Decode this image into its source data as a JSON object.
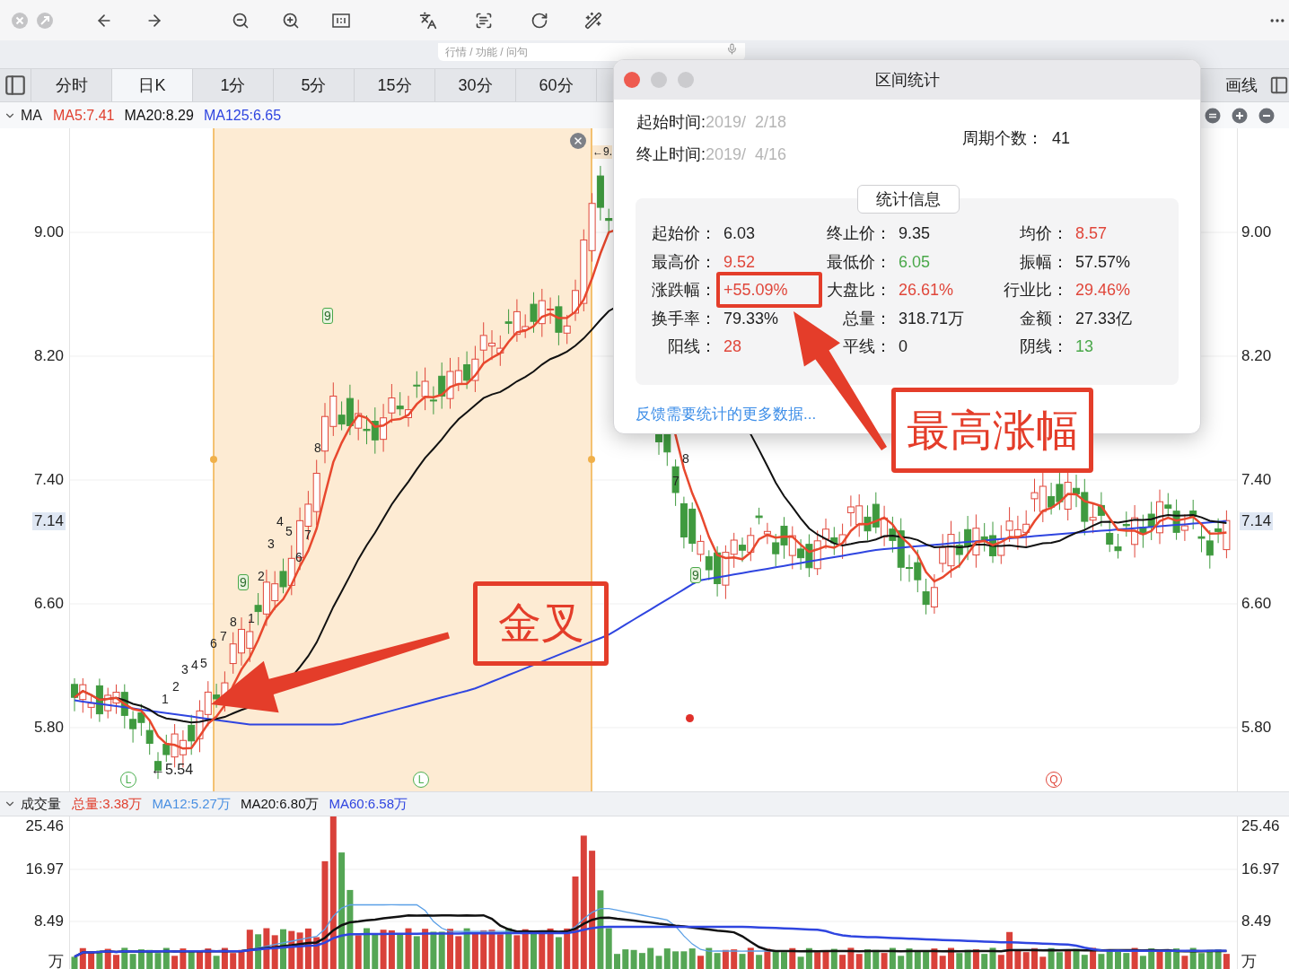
{
  "toolbar": {
    "search": {
      "placeholder": "行情 / 功能 / 问句"
    }
  },
  "period_tabs": [
    {
      "label": "分时",
      "selected": false
    },
    {
      "label": "日K",
      "selected": true
    },
    {
      "label": "1分",
      "selected": false
    },
    {
      "label": "5分",
      "selected": false
    },
    {
      "label": "15分",
      "selected": false
    },
    {
      "label": "30分",
      "selected": false
    },
    {
      "label": "60分",
      "selected": false
    }
  ],
  "draw_button": {
    "label": "画线"
  },
  "ma_legend": {
    "title": "MA",
    "items": [
      {
        "text": "MA5:7.41",
        "color": "#e0402f"
      },
      {
        "text": "MA20:8.29",
        "color": "#111111"
      },
      {
        "text": "MA125:6.65",
        "color": "#2f45e0"
      }
    ]
  },
  "left_price_axis": [
    {
      "text": "9.00",
      "highlighted": false
    },
    {
      "text": "8.20",
      "highlighted": false
    },
    {
      "text": "7.40",
      "highlighted": false
    },
    {
      "text": "7.14",
      "highlighted": true
    },
    {
      "text": "6.60",
      "highlighted": false
    },
    {
      "text": "5.80",
      "highlighted": false
    }
  ],
  "right_price_axis": [
    {
      "text": "9.00",
      "highlighted": false
    },
    {
      "text": "8.20",
      "highlighted": false
    },
    {
      "text": "7.40",
      "highlighted": false
    },
    {
      "text": "7.14",
      "highlighted": true
    },
    {
      "text": "6.60",
      "highlighted": false
    },
    {
      "text": "5.80",
      "highlighted": false
    }
  ],
  "price_labels": {
    "low": "←5.54",
    "high": "←9."
  },
  "count_marks": [
    {
      "text": "9",
      "boxed": true
    },
    {
      "text": "8",
      "boxed": false
    },
    {
      "text": "4",
      "boxed": false
    },
    {
      "text": "5",
      "boxed": false
    },
    {
      "text": "7",
      "boxed": false
    },
    {
      "text": "3",
      "boxed": false
    },
    {
      "text": "6",
      "boxed": false
    },
    {
      "text": "9",
      "boxed": true
    },
    {
      "text": "2",
      "boxed": false
    },
    {
      "text": "8",
      "boxed": false
    },
    {
      "text": "1",
      "boxed": false
    },
    {
      "text": "6",
      "boxed": false
    },
    {
      "text": "7",
      "boxed": false
    },
    {
      "text": "3",
      "boxed": false
    },
    {
      "text": "4",
      "boxed": false
    },
    {
      "text": "5",
      "boxed": false
    },
    {
      "text": "2",
      "boxed": false
    },
    {
      "text": "1",
      "boxed": false
    },
    {
      "text": "8",
      "boxed": false
    },
    {
      "text": "7",
      "boxed": false
    },
    {
      "text": "9",
      "boxed": true
    }
  ],
  "signals": [
    {
      "text": "L",
      "color": "#4caf50"
    },
    {
      "text": "L",
      "color": "#4caf50"
    },
    {
      "text": "Q",
      "color": "#e0463a"
    }
  ],
  "volume_legend": {
    "title": "成交量",
    "items": [
      {
        "text": "总量:3.38万",
        "color": "#e0402f"
      },
      {
        "text": "MA12:5.27万",
        "color": "#4a90e2"
      },
      {
        "text": "MA20:6.80万",
        "color": "#111111"
      },
      {
        "text": "MA60:6.58万",
        "color": "#2f45e0"
      }
    ]
  },
  "left_volume_axis": [
    "25.46",
    "16.97",
    "8.49",
    "万"
  ],
  "right_volume_axis": [
    "25.46",
    "16.97",
    "8.49",
    "万"
  ],
  "dialog": {
    "title": "区间统计",
    "start": {
      "label": "起始时间:",
      "value": "2019/  2/18"
    },
    "end": {
      "label": "终止时间:",
      "value": "2019/  4/16"
    },
    "periods": {
      "label": "周期个数：",
      "value": "41"
    },
    "section_title": "统计信息",
    "stats": [
      {
        "label": "起始价：",
        "value": "6.03",
        "color": "#222222"
      },
      {
        "label": "终止价：",
        "value": "9.35",
        "color": "#222222"
      },
      {
        "label": "均价：",
        "value": "8.57",
        "color": "#e0463a"
      },
      {
        "label": "最高价：",
        "value": "9.52",
        "color": "#e0463a"
      },
      {
        "label": "最低价：",
        "value": "6.05",
        "color": "#4aa84a"
      },
      {
        "label": "振幅：",
        "value": "57.57%",
        "color": "#222222"
      },
      {
        "label": "涨跌幅：",
        "value": "+55.09%",
        "color": "#e0463a"
      },
      {
        "label": "大盘比：",
        "value": "26.61%",
        "color": "#e0463a"
      },
      {
        "label": "行业比：",
        "value": "29.46%",
        "color": "#e0463a"
      },
      {
        "label": "换手率：",
        "value": "79.33%",
        "color": "#222222"
      },
      {
        "label": "总量：",
        "value": "318.71万",
        "color": "#222222"
      },
      {
        "label": "金额：",
        "value": "27.33亿",
        "color": "#222222"
      },
      {
        "label": "阳线：",
        "value": "28",
        "color": "#e0463a"
      },
      {
        "label": "平线：",
        "value": "0",
        "color": "#222222"
      },
      {
        "label": "阴线：",
        "value": "13",
        "color": "#4aa84a"
      }
    ],
    "link": "反馈需要统计的更多数据..."
  },
  "annotations": {
    "golden_cross": "金叉",
    "max_gain": "最高涨幅"
  }
}
